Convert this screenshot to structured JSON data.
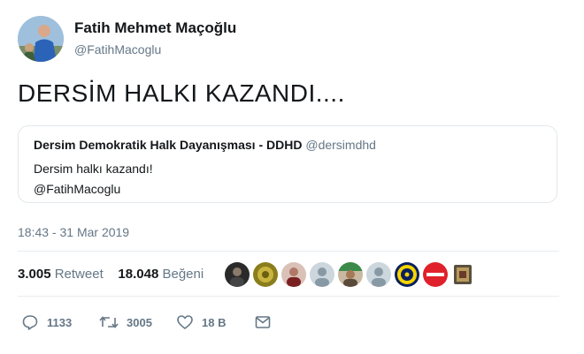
{
  "author": {
    "name": "Fatih Mehmet Maçoğlu",
    "handle": "@FatihMacoglu"
  },
  "tweet": {
    "text": "DERSİM HALKI KAZANDI...."
  },
  "quote": {
    "name": "Dersim Demokratik Halk Dayanışması - DDHD",
    "handle": "@dersimdhd",
    "line1": "Dersim halkı kazandı!",
    "line2": "@FatihMacoglu"
  },
  "timestamp": "18:43 - 31 Mar 2019",
  "stats": {
    "retweets_count": "3.005",
    "retweets_label": "Retweet",
    "likes_count": "18.048",
    "likes_label": "Beğeni"
  },
  "actions": {
    "reply_count": "1133",
    "retweet_count": "3005",
    "like_count": "18 B",
    "icons": [
      "reply-icon",
      "retweet-icon",
      "heart-icon",
      "message-icon"
    ]
  },
  "colors": {
    "text": "#14171a",
    "secondary": "#657786",
    "border": "#e1e8ed"
  }
}
